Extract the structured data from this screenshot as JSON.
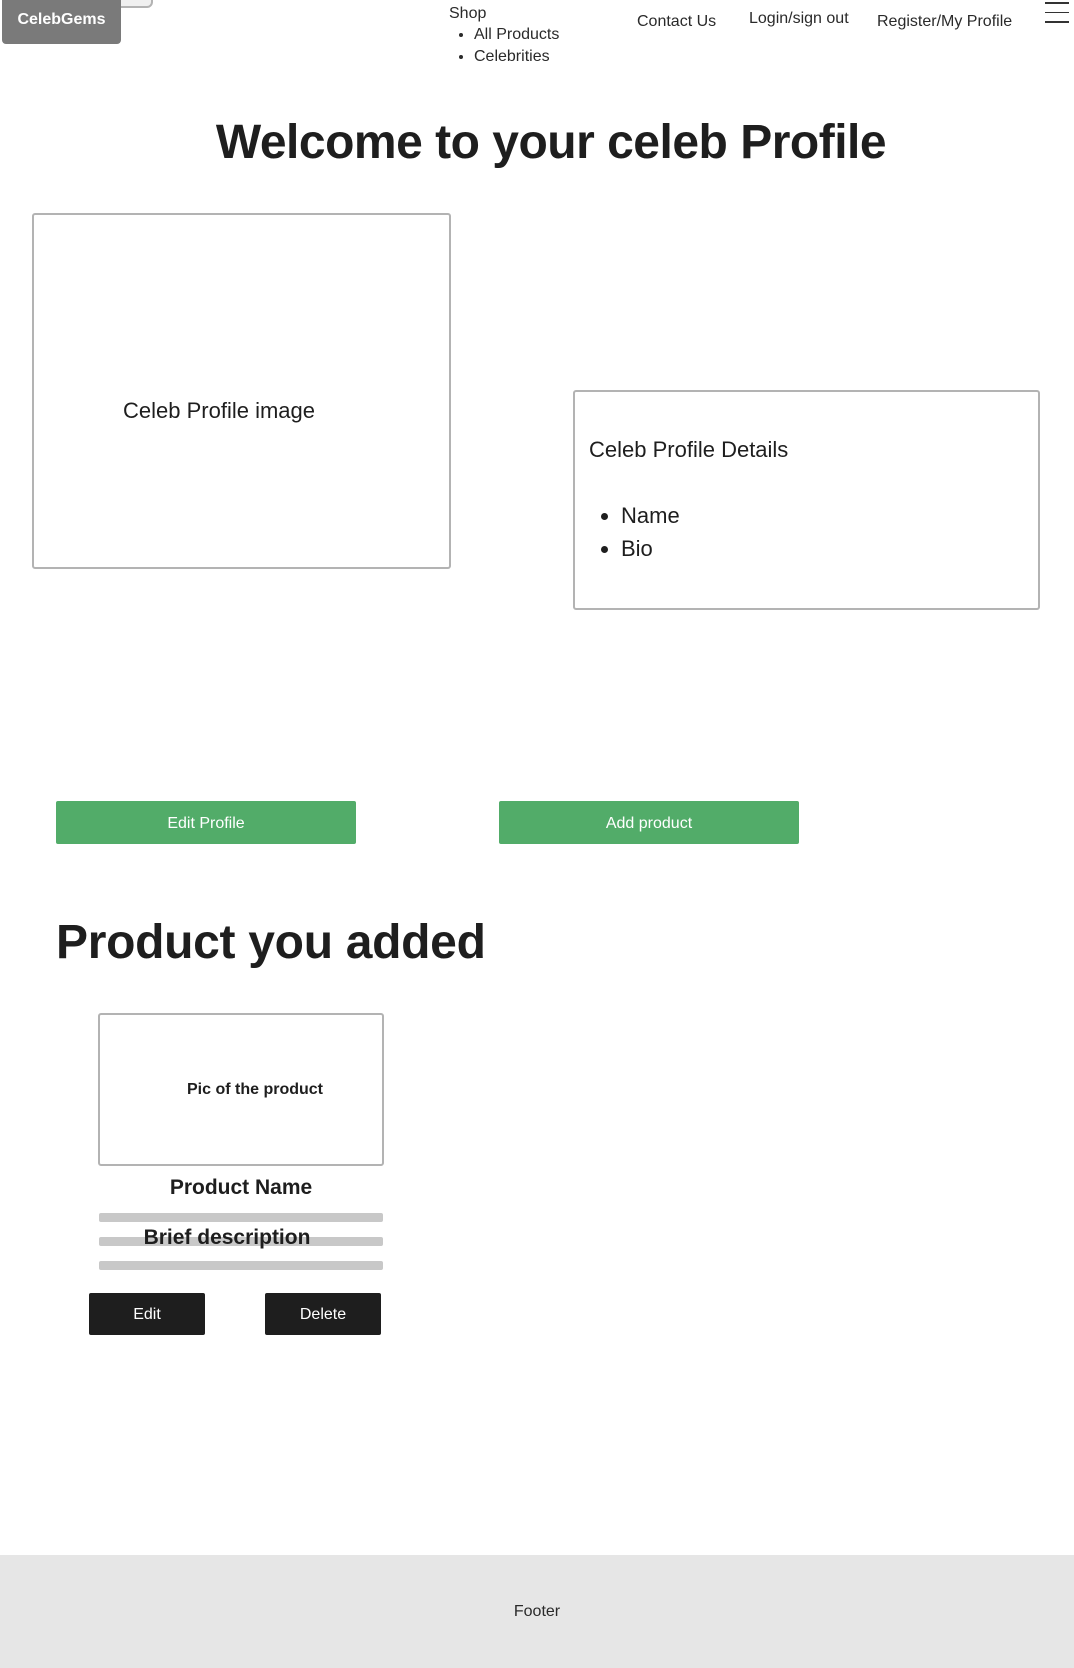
{
  "header": {
    "logo": "CelebGems",
    "nav": {
      "shop": "Shop",
      "shop_items": [
        "All Products",
        "Celebrities"
      ],
      "contact": "Contact Us",
      "login": "Login/sign out",
      "register": "Register/My Profile"
    },
    "menu_icon": "hamburger-menu-icon"
  },
  "hero": {
    "title": "Welcome to your celeb Profile",
    "profile_image_label": "Celeb Profile image",
    "details": {
      "title": "Celeb Profile Details",
      "items": [
        "Name",
        "Bio"
      ]
    }
  },
  "actions": {
    "edit_profile": "Edit Profile",
    "add_product": "Add product"
  },
  "products_section": {
    "title": "Product you added",
    "product": {
      "pic_label": "Pic of the product",
      "name": "Product Name",
      "description": "Brief description",
      "edit": "Edit",
      "delete": "Delete"
    }
  },
  "footer": {
    "text": "Footer"
  },
  "colors": {
    "accent_green": "#52ac69",
    "dark_button": "#1e1e1e",
    "logo_bg": "#7a7a7a",
    "footer_bg": "#e6e6e6",
    "border_gray": "#b3b3b3"
  }
}
